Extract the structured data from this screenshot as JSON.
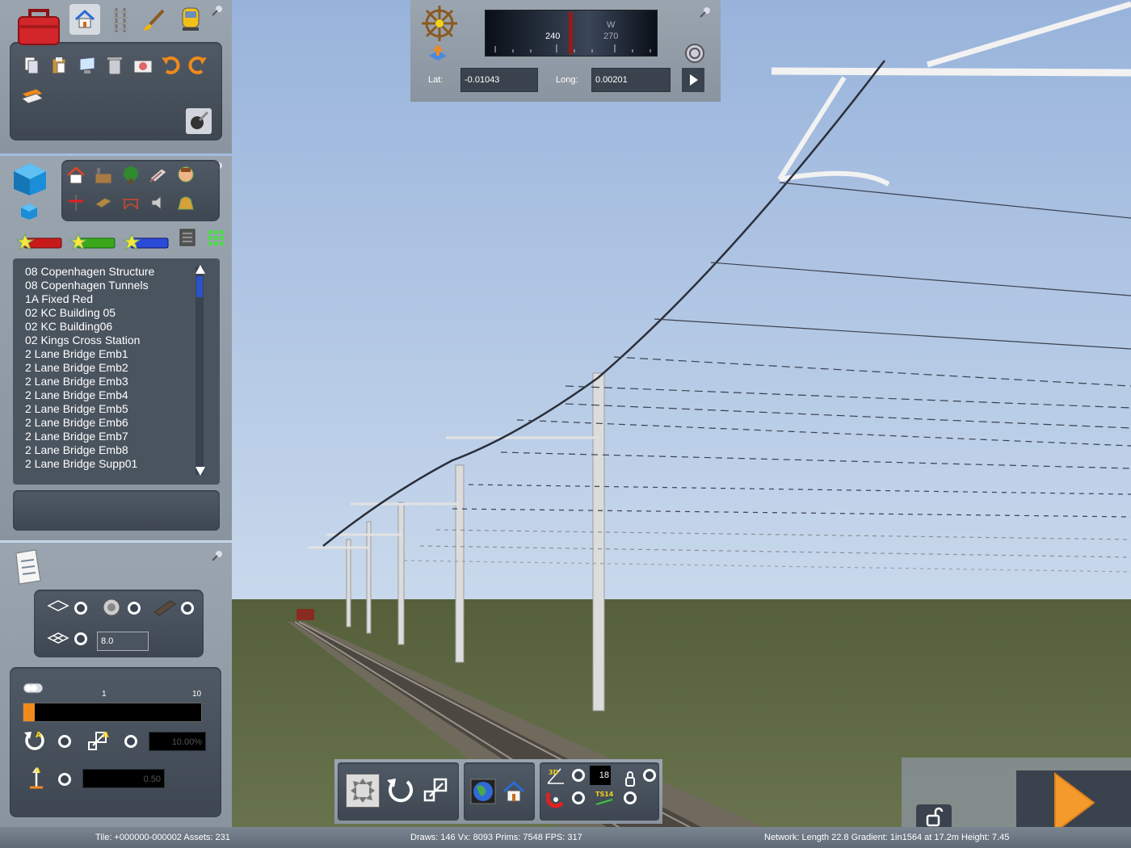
{
  "compass": {
    "heading_240": "240",
    "heading_w": "W",
    "heading_270": "270"
  },
  "coords": {
    "lat_label": "Lat:",
    "lat_value": "-0.01043",
    "long_label": "Long:",
    "long_value": "0.00201"
  },
  "assets": {
    "items": [
      "08 Copenhagen Structure",
      "08 Copenhagen Tunnels",
      "1A Fixed Red",
      "02 KC Building 05",
      "02 KC Building06",
      "02 Kings Cross Station",
      "2 Lane Bridge Emb1",
      "2 Lane Bridge Emb2",
      "2 Lane Bridge Emb3",
      "2 Lane Bridge Emb4",
      "2 Lane Bridge Emb5",
      "2 Lane Bridge Emb6",
      "2 Lane Bridge Emb7",
      "2 Lane Bridge Emb8",
      "2 Lane Bridge Supp01"
    ]
  },
  "properties": {
    "spacing_value": "8.0",
    "slider_min": "1",
    "slider_max": "10",
    "slider_fraction": 0.02,
    "rotation_percent": "10.00%",
    "height_value": "0.50"
  },
  "bottom_toolbar": {
    "counter": "18",
    "ts_label": "TS14",
    "label_3d": "3D"
  },
  "status": {
    "tile": "Tile: +000000-000002  Assets: 231",
    "draws": "Draws: 146 Vx: 8093 Prims: 7548 FPS: 317",
    "network": "Network:  Length   22.8 Gradient:  1in1564 at 17.2m Height:   7.45"
  },
  "colors": {
    "sky_top": "#9cb6dc",
    "sky_bottom": "#c2d4ea",
    "ground": "#5f6a43",
    "panel": "#959fab",
    "accent_orange": "#f08a1c"
  }
}
